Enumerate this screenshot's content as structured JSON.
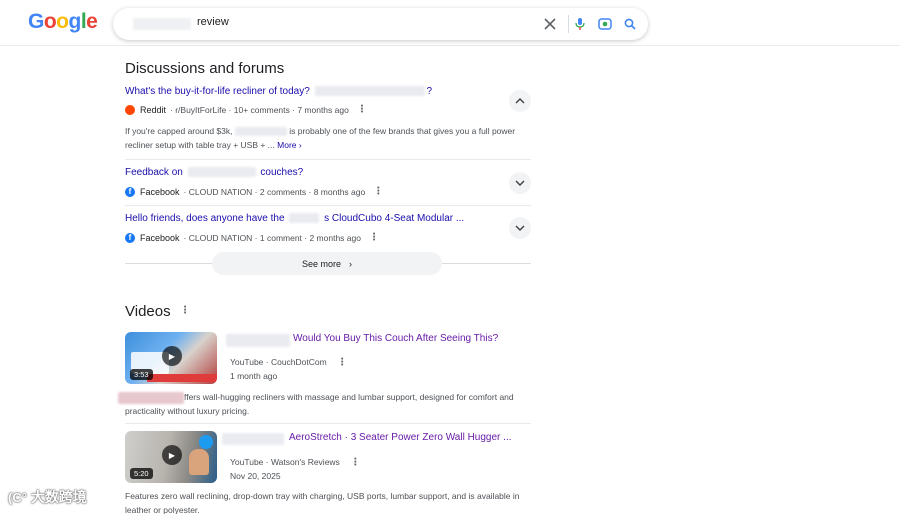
{
  "header": {
    "logo_text": "Google",
    "search_query": "review",
    "icons": [
      "close-icon",
      "microphone-icon",
      "lens-icon",
      "search-icon"
    ]
  },
  "discussions": {
    "title": "Discussions and forums",
    "items": [
      {
        "title_prefix": "What's the buy-it-for-life recliner of today?",
        "title_suffix": "?",
        "source": "Reddit",
        "meta": "· r/BuyItForLife · 10+ comments · 7 months ago",
        "snippet_a": "If you're capped around $3k,",
        "snippet_b": "is probably one of the few brands that gives you a full power",
        "snippet_c": "recliner setup with table tray + USB + ...",
        "more_label": "More ›",
        "expand_icon": "chevron-up-icon"
      },
      {
        "title_prefix": "Feedback on",
        "title_suffix": "couches?",
        "source": "Facebook",
        "meta": "· CLOUD NATION · 2 comments · 8 months ago",
        "expand_icon": "chevron-down-icon"
      },
      {
        "title_prefix": "Hello friends, does anyone have the",
        "title_suffix": "s CloudCubo 4-Seat Modular ...",
        "source": "Facebook",
        "meta": "· CLOUD NATION · 1 comment · 2 months ago",
        "expand_icon": "chevron-down-icon"
      }
    ],
    "see_more": "See more"
  },
  "videos": {
    "title": "Videos",
    "items": [
      {
        "title": "Would You Buy This Couch After Seeing This?",
        "channel": "YouTube · CouchDotCom",
        "date": "1 month ago",
        "duration": "3:53",
        "snippet_a": "ffers wall-hugging recliners with massage and lumbar support, designed for comfort and",
        "snippet_b": "practicality without luxury pricing."
      },
      {
        "title": "AeroStretch · 3 Seater Power Zero Wall Hugger ...",
        "channel": "YouTube · Watson's Reviews",
        "date": "Nov 20, 2025",
        "duration": "5:20",
        "snippet_a": "Features zero wall reclining, drop-down tray with charging, USB ports, lumbar support, and is available in",
        "snippet_b": "leather or polyester."
      }
    ]
  },
  "watermark": "大数跨境"
}
